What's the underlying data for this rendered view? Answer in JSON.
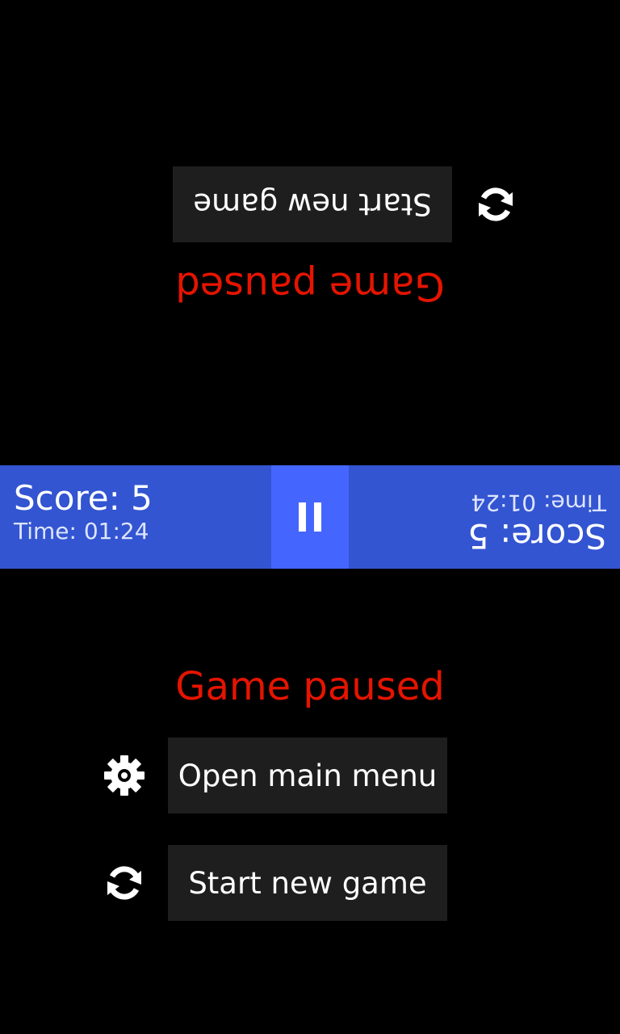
{
  "pause_menu": {
    "title": "Game paused",
    "open_main_menu_label": "Open main menu",
    "start_new_game_label": "Start new game",
    "gear_icon": "gear-icon",
    "refresh_icon": "refresh-icon"
  },
  "opponent_pause_menu": {
    "title": "Game paused",
    "start_new_game_label": "Start new game",
    "refresh_icon": "refresh-icon"
  },
  "status_bar": {
    "player1": {
      "score_text": "Score: 5",
      "time_text": "Time: 01:24"
    },
    "player2": {
      "score_text": "Score: 5",
      "time_text": "Time: 01:24"
    },
    "pause_icon": "pause-icon"
  },
  "colors": {
    "background": "#000000",
    "status_bar": "#3355d1",
    "pause_button": "#4466ff",
    "title_red": "#e51400",
    "button_bg": "#1e1e1e"
  }
}
